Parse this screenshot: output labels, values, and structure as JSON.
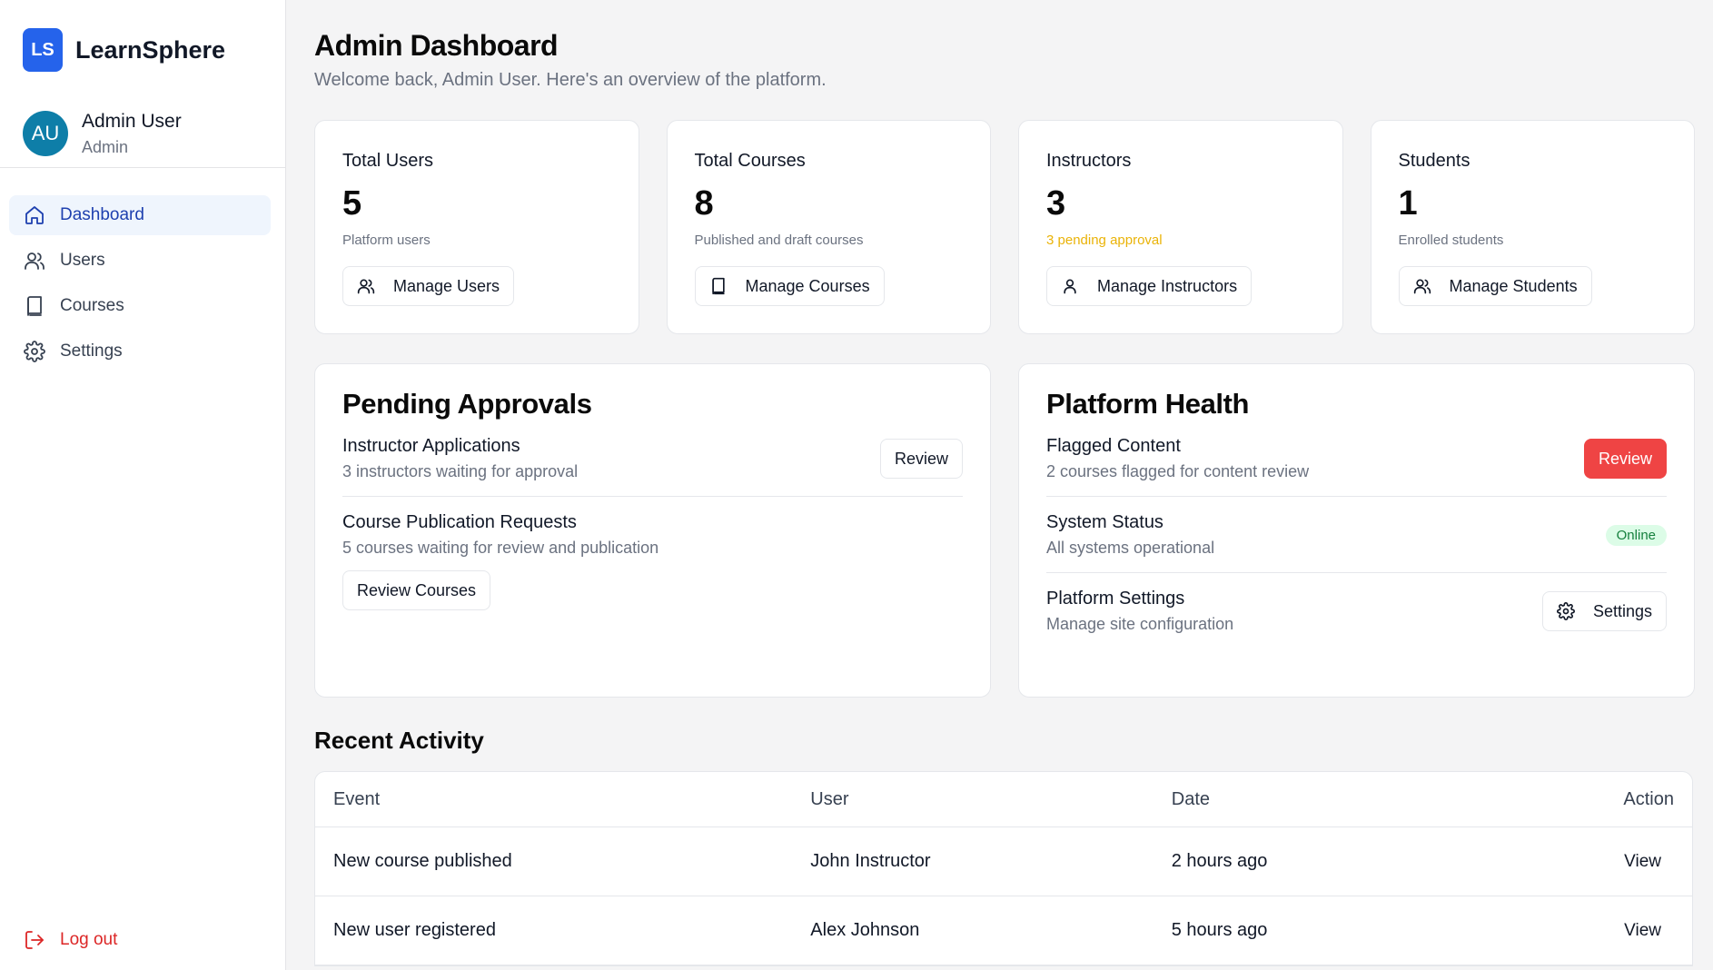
{
  "brand": {
    "logo": "LS",
    "name": "LearnSphere",
    "color": "#2563eb"
  },
  "profile": {
    "initials": "AU",
    "name": "Admin User",
    "role": "Admin"
  },
  "nav": [
    {
      "label": "Dashboard",
      "icon": "home-icon",
      "active": true
    },
    {
      "label": "Users",
      "icon": "users-icon"
    },
    {
      "label": "Courses",
      "icon": "book-icon"
    },
    {
      "label": "Settings",
      "icon": "gear-icon"
    }
  ],
  "logout": {
    "label": "Log out",
    "icon": "logout-icon",
    "color": "#dc2626"
  },
  "header": {
    "title": "Admin Dashboard",
    "subtitle": "Welcome back, Admin User. Here's an overview of the platform."
  },
  "stats": [
    {
      "label": "Total Users",
      "value": "5",
      "note": "Platform users",
      "button": "Manage Users",
      "icon": "users-icon"
    },
    {
      "label": "Total Courses",
      "value": "8",
      "note": "Published and draft courses",
      "button": "Manage Courses",
      "icon": "book-icon"
    },
    {
      "label": "Instructors",
      "value": "3",
      "note": "3 pending approval",
      "note_color": "#eab308",
      "button": "Manage Instructors",
      "icon": "user-icon"
    },
    {
      "label": "Students",
      "value": "1",
      "note": "Enrolled students",
      "button": "Manage Students",
      "icon": "users-icon"
    }
  ],
  "pending": {
    "title": "Pending Approvals",
    "items": [
      {
        "title": "Instructor Applications",
        "desc": "3 instructors waiting for approval",
        "button": "Review"
      },
      {
        "title": "Course Publication Requests",
        "desc": "5 courses waiting for review and publication",
        "button": "Review Courses"
      }
    ]
  },
  "health": {
    "title": "Platform Health",
    "items": [
      {
        "title": "Flagged Content",
        "desc": "2 courses flagged for content review",
        "button": "Review",
        "button_color": "#ef4444"
      },
      {
        "title": "System Status",
        "desc": "All systems operational",
        "badge": "Online",
        "badge_color": "#dcfce7"
      },
      {
        "title": "Platform Settings",
        "desc": "Manage site configuration",
        "button": "Settings",
        "icon": "gear-icon"
      }
    ]
  },
  "activity": {
    "title": "Recent Activity",
    "columns": [
      "Event",
      "User",
      "Date",
      "Action"
    ],
    "rows": [
      {
        "event": "New course published",
        "user": "John Instructor",
        "date": "2 hours ago",
        "action": "View"
      },
      {
        "event": "New user registered",
        "user": "Alex Johnson",
        "date": "5 hours ago",
        "action": "View"
      }
    ]
  }
}
